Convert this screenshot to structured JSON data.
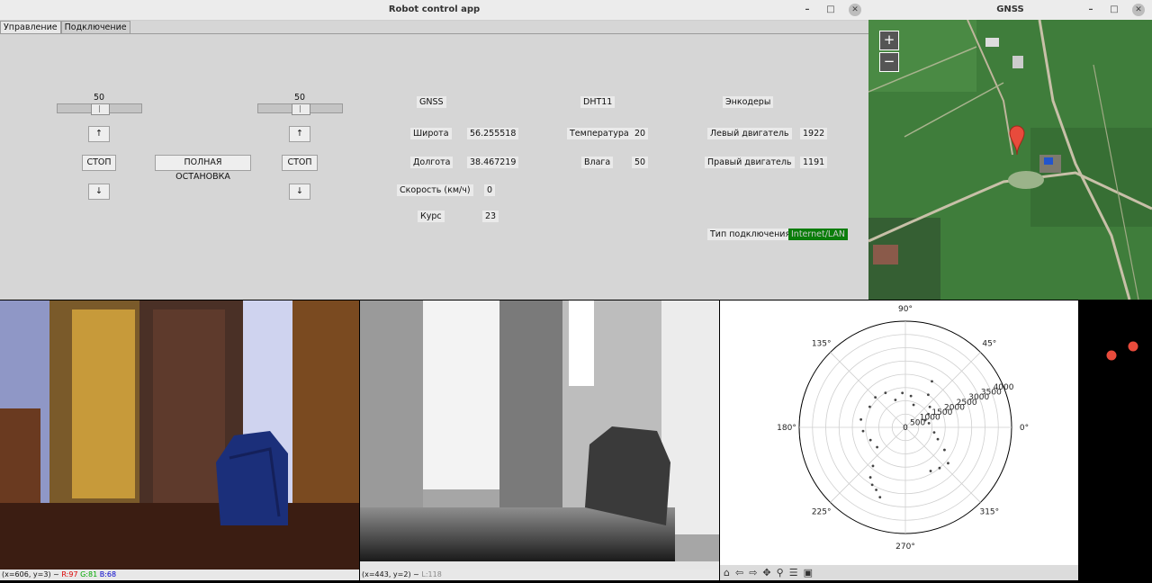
{
  "robot": {
    "title": "Robot control app",
    "tabs": [
      "Управление",
      "Подключение"
    ],
    "left_slider_value": "50",
    "right_slider_value": "50",
    "up_arrow": "↑",
    "down_arrow": "↓",
    "stop_label": "СТОП",
    "full_stop_label": "ПОЛНАЯ ОСТАНОВКА",
    "gnss": {
      "header": "GNSS",
      "lat_label": "Широта",
      "lat": "56.255518",
      "lon_label": "Долгота",
      "lon": "38.467219",
      "speed_label": "Скорость (км/ч)",
      "speed": "0",
      "course_label": "Курс",
      "course": "23"
    },
    "dht": {
      "header": "DHT11",
      "temp_label": "Температура",
      "temp": "20",
      "hum_label": "Влага",
      "hum": "50"
    },
    "enc": {
      "header": "Энкодеры",
      "left_label": "Левый двигатель",
      "left": "1922",
      "right_label": "Правый двигатель",
      "right": "1191"
    },
    "conn": {
      "label": "Тип подключения",
      "value": "Internet/LAN"
    }
  },
  "gnss_window": {
    "title": "GNSS",
    "zoom_in": "+",
    "zoom_out": "−"
  },
  "rgb_status": {
    "coords": "(x=606, y=3) ~ ",
    "r": "R:97",
    "g": "G:81",
    "b": "B:68"
  },
  "depth_status": {
    "coords": "(x=443, y=2) ~ ",
    "l": "L:118"
  },
  "chart_data": {
    "type": "scatter",
    "projection": "polar",
    "title": "",
    "angle_ticks": [
      "0°",
      "45°",
      "90°",
      "135°",
      "180°",
      "225°",
      "270°",
      "315°"
    ],
    "radial_ticks": [
      0,
      500,
      1000,
      1500,
      2000,
      2500,
      3000,
      3500,
      4000
    ],
    "rlim": [
      0,
      4000
    ],
    "grid": true,
    "legend": "none",
    "series": [
      {
        "color": "#444444",
        "points_deg_r": [
          [
            80,
            1200
          ],
          [
            70,
            900
          ],
          [
            95,
            1300
          ],
          [
            110,
            1100
          ],
          [
            120,
            1500
          ],
          [
            135,
            1600
          ],
          [
            150,
            1550
          ],
          [
            170,
            1700
          ],
          [
            185,
            1600
          ],
          [
            200,
            1400
          ],
          [
            215,
            1300
          ],
          [
            230,
            1900
          ],
          [
            235,
            2300
          ],
          [
            240,
            2500
          ],
          [
            245,
            2600
          ],
          [
            250,
            2800
          ],
          [
            300,
            1900
          ],
          [
            310,
            2000
          ],
          [
            320,
            2100
          ],
          [
            330,
            1700
          ],
          [
            340,
            1300
          ],
          [
            350,
            1100
          ],
          [
            10,
            900
          ],
          [
            20,
            800
          ],
          [
            30,
            1000
          ],
          [
            40,
            1200
          ],
          [
            55,
            1500
          ],
          [
            60,
            2000
          ]
        ]
      }
    ]
  },
  "colors": {
    "conn_bg": "#0a7d0a",
    "marker_red": "#e84b3c"
  }
}
